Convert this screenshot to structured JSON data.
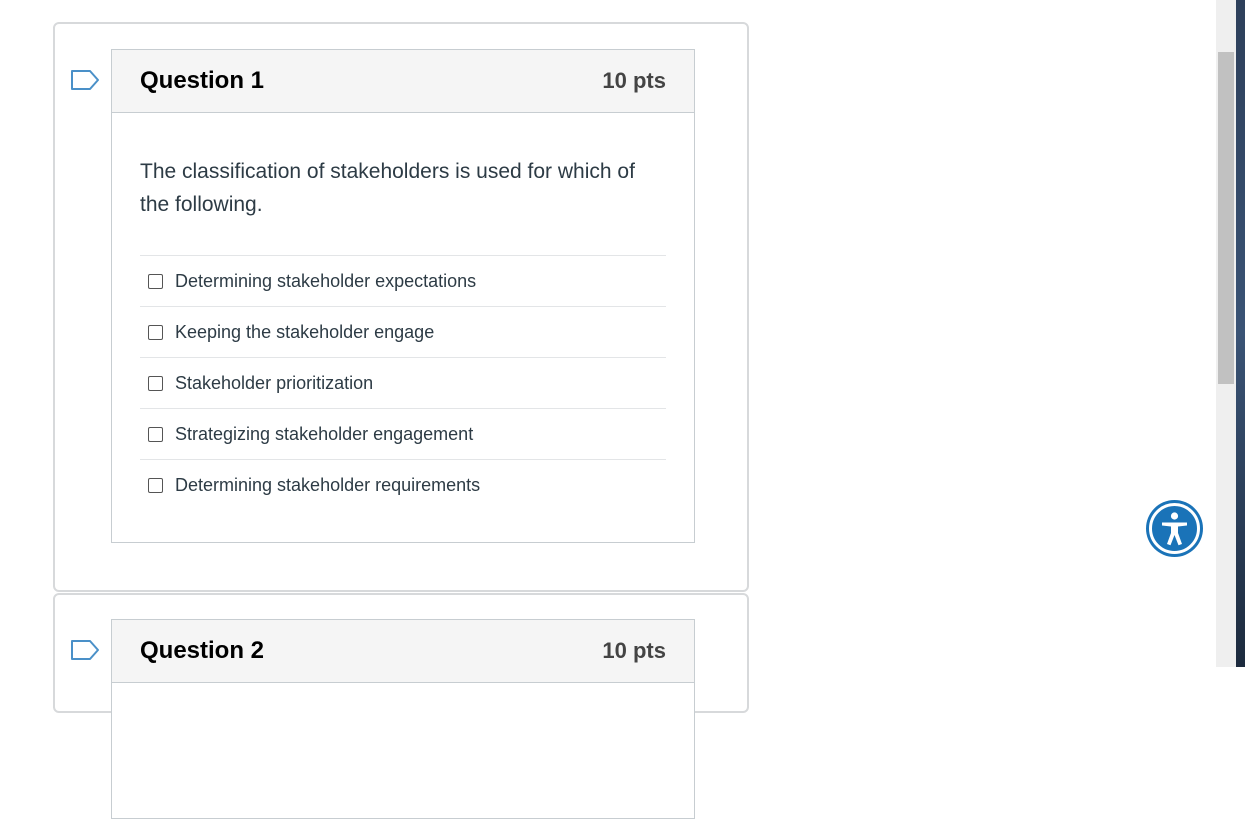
{
  "questions": [
    {
      "name": "Question 1",
      "points": "10 pts",
      "text": "The classification of stakeholders is used for which of the following.",
      "answers": [
        "Determining stakeholder expectations",
        "Keeping the stakeholder engage",
        "Stakeholder prioritization",
        "Strategizing stakeholder engagement",
        "Determining stakeholder requirements"
      ]
    },
    {
      "name": "Question 2",
      "points": "10 pts"
    }
  ],
  "icons": {
    "flag": "flag-icon",
    "accessibility": "accessibility-icon"
  },
  "colors": {
    "accent": "#1a73b8",
    "flag_outline": "#4a90c8",
    "header_bg": "#f5f5f5"
  }
}
